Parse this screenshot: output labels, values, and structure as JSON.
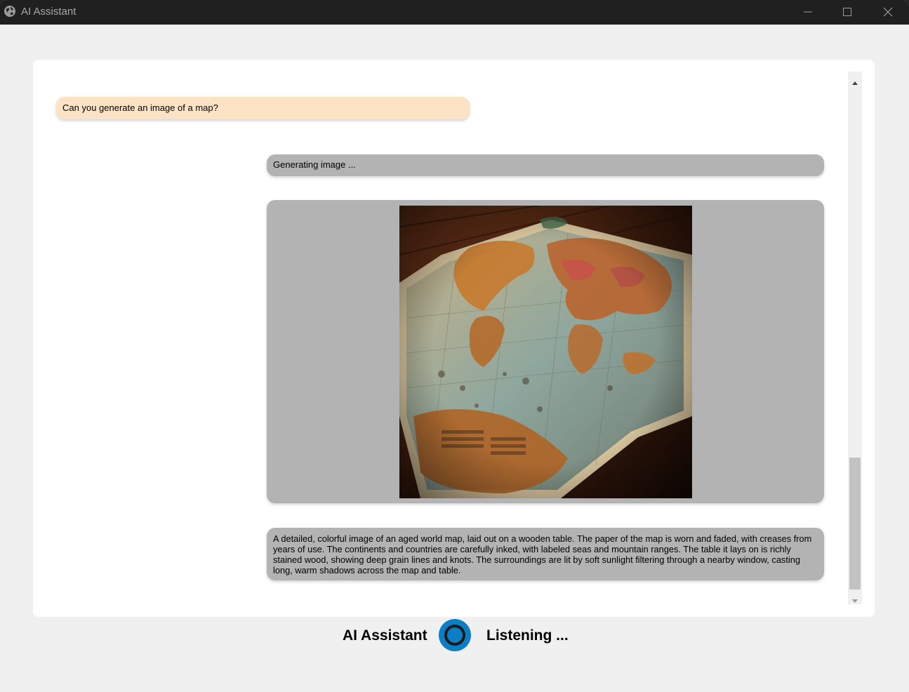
{
  "window": {
    "title": "AI Assistant",
    "icon": "globe-icon"
  },
  "titlebar_buttons": {
    "minimize_icon": "minimize-icon",
    "maximize_icon": "maximize-icon",
    "close_icon": "close-icon"
  },
  "chat": {
    "messages": [
      {
        "role": "user",
        "text": "Can you generate an image of a map?"
      },
      {
        "role": "assistant",
        "text": "Generating image ..."
      },
      {
        "role": "assistant",
        "type": "image",
        "depiction": "aged world map on wooden table"
      },
      {
        "role": "assistant",
        "text": "A detailed, colorful image of an aged world map, laid out on a wooden table. The paper of the map is worn and faded, with creases from years of use. The continents and countries are carefully inked, with labeled seas and mountain ranges. The table it lays on is richly stained wood, showing deep grain lines and knots. The surroundings are lit by soft sunlight filtering through a nearby window, casting long, warm shadows across the map and table."
      }
    ]
  },
  "footer": {
    "assistant_label": "AI Assistant",
    "status": "Listening ..."
  },
  "colors": {
    "user_bubble": "#fde3c5",
    "assistant_bubble": "#b3b3b3",
    "indicator": "#0b7ec6",
    "titlebar": "#202020",
    "background": "#f0f0f0"
  }
}
